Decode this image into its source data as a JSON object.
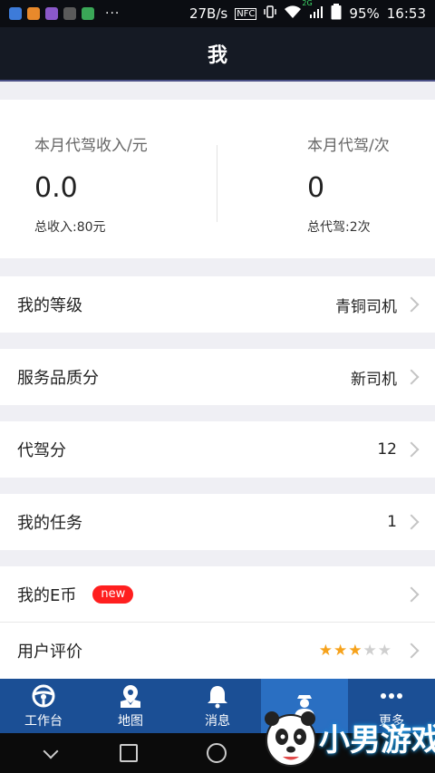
{
  "status_bar": {
    "speed": "27B/s",
    "nfc": "NFC",
    "network": "2G",
    "battery": "95%",
    "time": "16:53",
    "more": "···"
  },
  "header": {
    "title": "我"
  },
  "stats": {
    "left": {
      "label": "本月代驾收入/元",
      "value": "0.0",
      "sub": "总收入:80元"
    },
    "right": {
      "label": "本月代驾/次",
      "value": "0",
      "sub": "总代驾:2次"
    }
  },
  "rows": [
    {
      "label": "我的等级",
      "value": "青铜司机"
    },
    {
      "label": "服务品质分",
      "value": "新司机"
    },
    {
      "label": "代驾分",
      "value": "12"
    },
    {
      "label": "我的任务",
      "value": "1"
    },
    {
      "label": "我的E币",
      "badge": "new"
    },
    {
      "label": "用户评价",
      "rating": 3,
      "rating_max": 5
    }
  ],
  "tabs": [
    {
      "label": "工作台",
      "icon": "steering-wheel-icon"
    },
    {
      "label": "地图",
      "icon": "map-pin-icon"
    },
    {
      "label": "消息",
      "icon": "bell-icon"
    },
    {
      "label": "",
      "icon": "driver-icon",
      "active": true
    },
    {
      "label": "更多",
      "icon": "more-dots-icon"
    }
  ],
  "watermark": {
    "text": "小男游戏"
  },
  "colors": {
    "accent": "#1b4f95",
    "accent_active": "#2a6fc2",
    "star": "#f6a21b",
    "badge": "#ff1f1f"
  }
}
